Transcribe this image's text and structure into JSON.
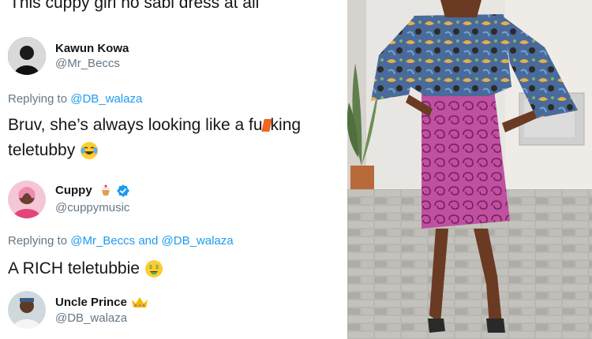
{
  "thread": {
    "top_tweet_text": "This cuppy girl no sabi dress at all",
    "tweet1": {
      "author_name": "Kawun Kowa",
      "author_handle": "@Mr_Beccs",
      "replying_prefix": "Replying to",
      "replying_to": "@DB_walaza",
      "text_line1_a": "Bruv, she’s always looking like a fu",
      "text_line1_b": "king",
      "text_line2": "teletubby",
      "emoji": "laughing-tears-emoji"
    },
    "tweet2": {
      "author_name": "Cuppy",
      "author_handle": "@cuppymusic",
      "name_emoji": "cupcake-emoji",
      "verified": true,
      "replying_prefix": "Replying to",
      "replying_to_1": "@Mr_Beccs",
      "replying_and": "and",
      "replying_to_2": "@DB_walaza",
      "text": "A RICH teletubbie",
      "emoji": "money-mouth-emoji"
    },
    "tweet3": {
      "author_name": "Uncle Prince",
      "author_handle": "@DB_walaza",
      "name_emoji": "crown-emoji"
    }
  },
  "colors": {
    "link": "#1d9bf0",
    "muted": "#657786",
    "text": "#14171a",
    "verified": "#1d9bf0",
    "censor": "#f26522"
  },
  "photo": {
    "subject": "woman-in-ankara-top-and-pink-skirt-photo"
  }
}
